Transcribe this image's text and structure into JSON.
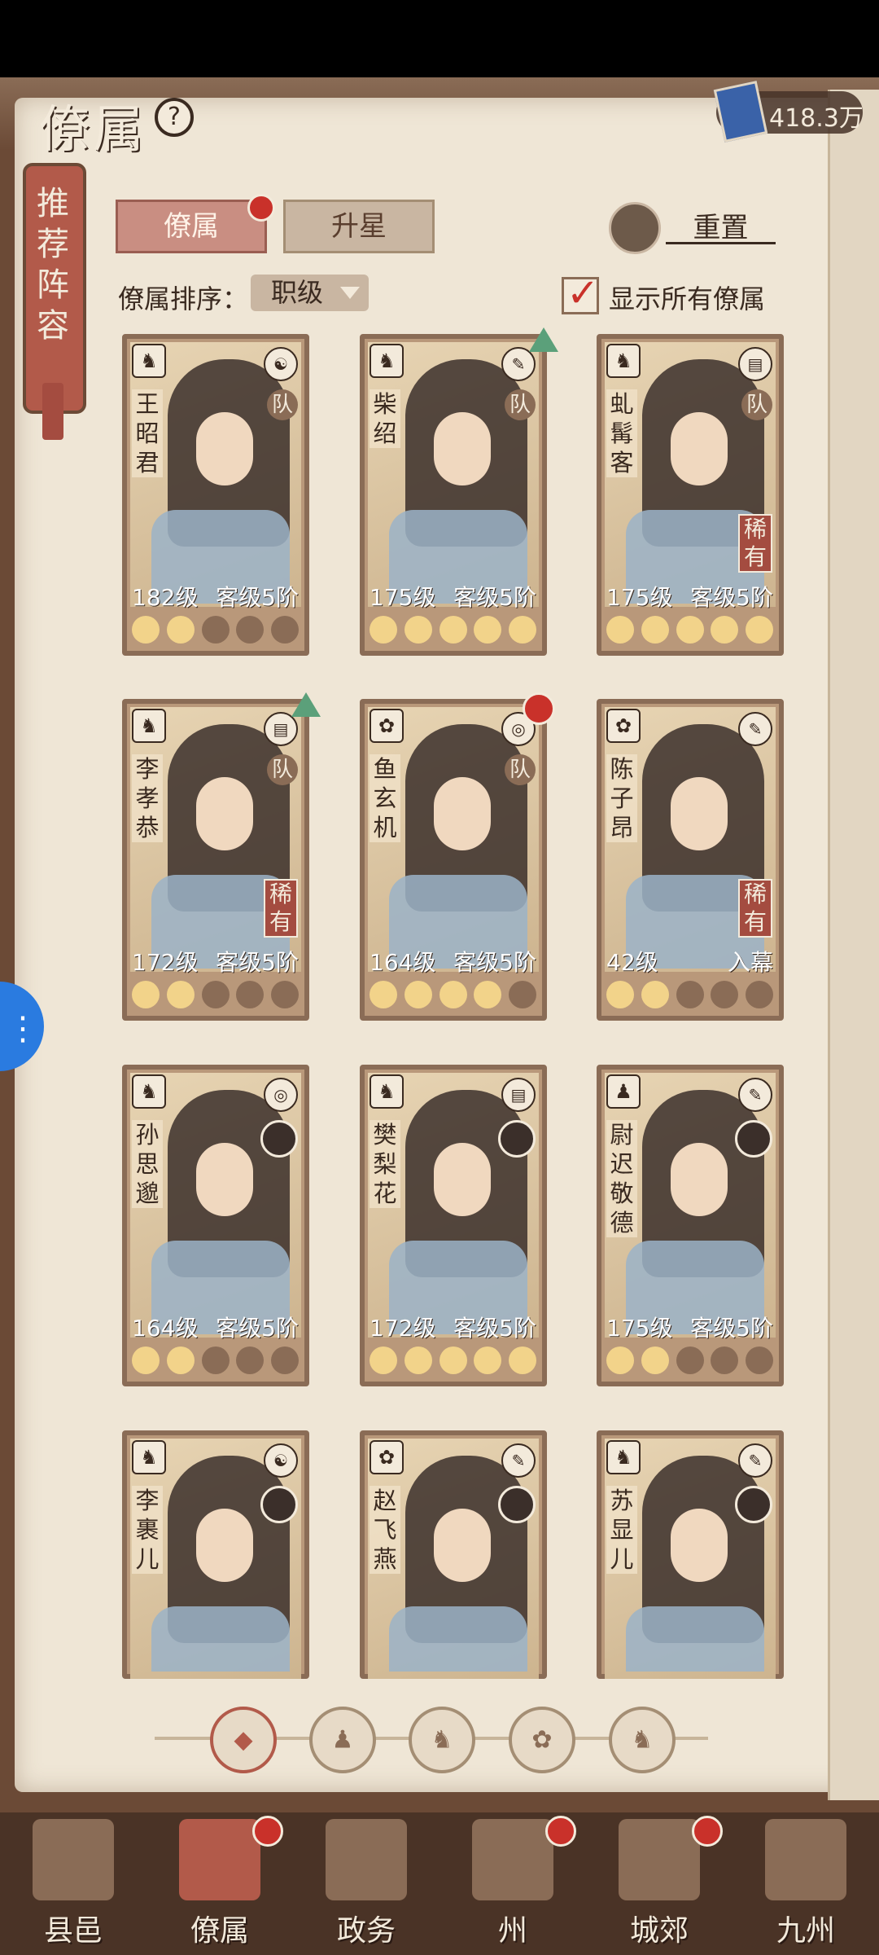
{
  "header": {
    "title": "僚属",
    "help_icon": "question-icon",
    "currency_value": "418.3万"
  },
  "recommend": {
    "label": "推荐阵容"
  },
  "tabs": [
    {
      "label": "僚属",
      "active": true,
      "badge": true
    },
    {
      "label": "升星",
      "active": false
    }
  ],
  "reset": {
    "label": "重置"
  },
  "sort": {
    "label": "僚属排序：",
    "value": "职级"
  },
  "show_all": {
    "label": "显示所有僚属",
    "checked": true
  },
  "cards": [
    {
      "name": "王昭君",
      "level": "182级",
      "rank": "客级5阶",
      "team": "队",
      "rare": "",
      "stars": 2,
      "arrow": false,
      "dot": false,
      "class": "♞",
      "faction": "☯",
      "mini": false
    },
    {
      "name": "柴绍",
      "level": "175级",
      "rank": "客级5阶",
      "team": "队",
      "rare": "",
      "stars": 5,
      "arrow": true,
      "dot": false,
      "class": "♞",
      "faction": "✎",
      "mini": false
    },
    {
      "name": "虬髯客",
      "level": "175级",
      "rank": "客级5阶",
      "team": "队",
      "rare": "稀有",
      "stars": 5,
      "arrow": false,
      "dot": false,
      "class": "♞",
      "faction": "▤",
      "mini": false
    },
    {
      "name": "李孝恭",
      "level": "172级",
      "rank": "客级5阶",
      "team": "队",
      "rare": "稀有",
      "stars": 2,
      "arrow": true,
      "dot": false,
      "class": "♞",
      "faction": "▤",
      "mini": false
    },
    {
      "name": "鱼玄机",
      "level": "164级",
      "rank": "客级5阶",
      "team": "队",
      "rare": "",
      "stars": 4,
      "arrow": false,
      "dot": true,
      "class": "✿",
      "faction": "◎",
      "mini": false
    },
    {
      "name": "陈子昂",
      "level": "42级",
      "rank": "入幕",
      "team": "",
      "rare": "稀有",
      "stars": 2,
      "arrow": false,
      "dot": false,
      "class": "✿",
      "faction": "✎",
      "mini": false
    },
    {
      "name": "孙思邈",
      "level": "164级",
      "rank": "客级5阶",
      "team": "",
      "rare": "",
      "stars": 2,
      "arrow": false,
      "dot": false,
      "class": "♞",
      "faction": "◎",
      "mini": true
    },
    {
      "name": "樊梨花",
      "level": "172级",
      "rank": "客级5阶",
      "team": "",
      "rare": "",
      "stars": 5,
      "arrow": false,
      "dot": false,
      "class": "♞",
      "faction": "▤",
      "mini": true
    },
    {
      "name": "尉迟敬德",
      "level": "175级",
      "rank": "客级5阶",
      "team": "",
      "rare": "",
      "stars": 2,
      "arrow": false,
      "dot": false,
      "class": "♟",
      "faction": "✎",
      "mini": true
    },
    {
      "name": "李裹儿",
      "level": "",
      "rank": "",
      "team": "",
      "rare": "",
      "stars": 0,
      "arrow": false,
      "dot": false,
      "class": "♞",
      "faction": "☯",
      "mini": true
    },
    {
      "name": "赵飞燕",
      "level": "",
      "rank": "",
      "team": "",
      "rare": "",
      "stars": 0,
      "arrow": false,
      "dot": false,
      "class": "✿",
      "faction": "✎",
      "mini": true
    },
    {
      "name": "苏显儿",
      "level": "",
      "rank": "",
      "team": "",
      "rare": "",
      "stars": 0,
      "arrow": false,
      "dot": false,
      "class": "♞",
      "faction": "✎",
      "mini": true
    }
  ],
  "filters": [
    {
      "name": "filter-all",
      "glyph": "◆",
      "active": true
    },
    {
      "name": "filter-faction-1",
      "glyph": "♟",
      "active": false
    },
    {
      "name": "filter-faction-2",
      "glyph": "♞",
      "active": false
    },
    {
      "name": "filter-faction-3",
      "glyph": "✿",
      "active": false
    },
    {
      "name": "filter-faction-4",
      "glyph": "♞",
      "active": false
    }
  ],
  "nav": [
    {
      "label": "县邑",
      "active": false,
      "dot": false
    },
    {
      "label": "僚属",
      "active": true,
      "dot": true
    },
    {
      "label": "政务",
      "active": false,
      "dot": false
    },
    {
      "label": "州",
      "active": false,
      "dot": true
    },
    {
      "label": "城郊",
      "active": false,
      "dot": true
    },
    {
      "label": "九州",
      "active": false,
      "dot": false
    }
  ]
}
